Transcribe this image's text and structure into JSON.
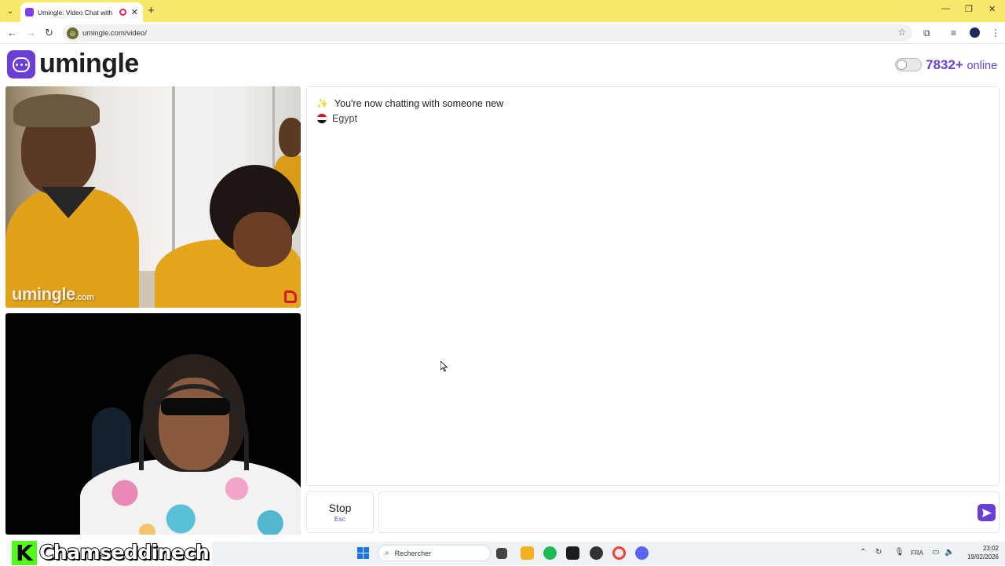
{
  "browser": {
    "tab_title": "Umingle: Video Chat with S",
    "tab_close": "✕",
    "new_tab": "+",
    "url": "umingle.com/video/",
    "controls": {
      "minimize": "—",
      "restore": "❐",
      "close": "✕"
    }
  },
  "site": {
    "logo_text": "umingle",
    "online_count": "7832+",
    "online_label": "online",
    "brand_color": "#6b3fd4"
  },
  "video": {
    "watermark": "umingle",
    "watermark_suffix": ".com"
  },
  "chat": {
    "status_message": "You're now chatting with someone new",
    "country": "Egypt",
    "stop_label": "Stop",
    "stop_shortcut": "Esc",
    "input_value": ""
  },
  "overlay": {
    "badge_letter": "K",
    "streamer_name": "Chamseddinech"
  },
  "taskbar": {
    "search_placeholder": "Rechercher",
    "language": "FRA",
    "time": "23:02",
    "date": "19/02/2026"
  }
}
